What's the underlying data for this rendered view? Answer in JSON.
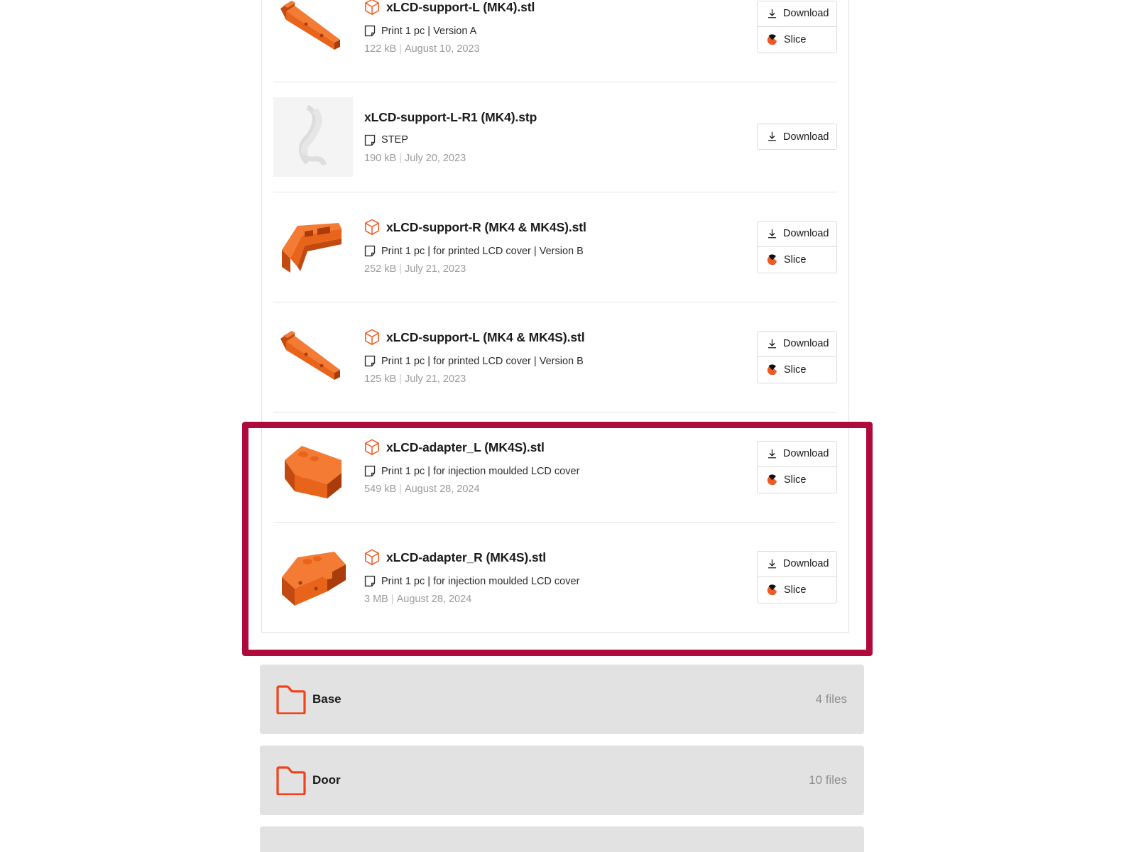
{
  "files": [
    {
      "name": "xLCD-support-L (MK4).stl",
      "meta": "Print 1 pc | Version A",
      "size": "122 kB",
      "date": "August 10, 2023",
      "type_icon": "cube-3d-icon",
      "thumb": "part-bracket-l",
      "buttons": [
        "Download",
        "Slice"
      ]
    },
    {
      "name": "xLCD-support-L-R1 (MK4).stp",
      "meta": "STEP",
      "size": "190 kB",
      "date": "July 20, 2023",
      "type_icon": "none",
      "thumb": "step-preview",
      "buttons": [
        "Download"
      ]
    },
    {
      "name": "xLCD-support-R (MK4 & MK4S).stl",
      "meta": "Print 1 pc | for printed LCD cover | Version B",
      "size": "252 kB",
      "date": "July 21, 2023",
      "type_icon": "cube-3d-icon",
      "thumb": "part-rail-r",
      "buttons": [
        "Download",
        "Slice"
      ]
    },
    {
      "name": "xLCD-support-L (MK4 & MK4S).stl",
      "meta": "Print 1 pc | for printed LCD cover | Version B",
      "size": "125 kB",
      "date": "July 21, 2023",
      "type_icon": "cube-3d-icon",
      "thumb": "part-bracket-l2",
      "buttons": [
        "Download",
        "Slice"
      ]
    },
    {
      "name": "xLCD-adapter_L (MK4S).stl",
      "meta": "Print 1 pc | for injection moulded LCD cover",
      "size": "549 kB",
      "date": "August 28, 2024",
      "type_icon": "cube-3d-icon",
      "thumb": "part-adapter-l",
      "buttons": [
        "Download",
        "Slice"
      ]
    },
    {
      "name": "xLCD-adapter_R (MK4S).stl",
      "meta": "Print 1 pc | for injection moulded LCD cover",
      "size": "3 MB",
      "date": "August 28, 2024",
      "type_icon": "cube-3d-icon",
      "thumb": "part-adapter-r",
      "buttons": [
        "Download",
        "Slice"
      ]
    }
  ],
  "folders": [
    {
      "name": "Base",
      "count": "4 files"
    },
    {
      "name": "Door",
      "count": "10 files"
    }
  ],
  "icons": {
    "download": "download-arrow-icon",
    "slice": "prusaslicer-icon",
    "doc": "document-page-icon",
    "cube": "cube-3d-icon",
    "folder": "folder-icon"
  },
  "colors": {
    "highlight": "#AF0A3C",
    "accent_orange": "#F15A22",
    "folder_bg": "#E2E2E2"
  }
}
